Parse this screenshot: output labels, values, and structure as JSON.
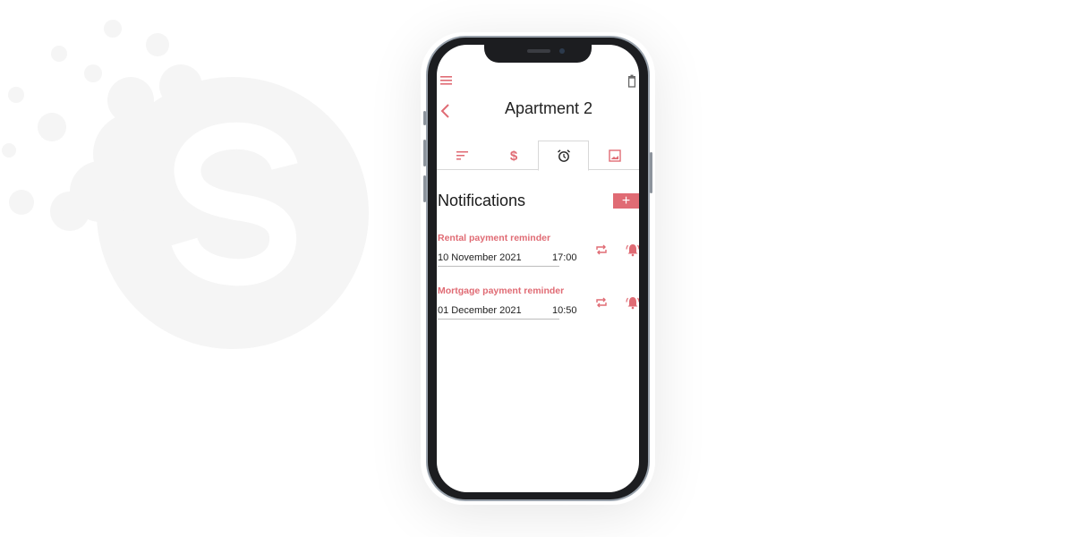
{
  "header": {
    "title": "Apartment 2",
    "menu_icon": "menu-icon",
    "trash_icon": "trash-icon",
    "back_icon": "chevron-left-icon"
  },
  "tabs": [
    {
      "name": "sort-icon",
      "active": false
    },
    {
      "name": "dollar-icon",
      "active": false
    },
    {
      "name": "alarm-clock-icon",
      "active": true
    },
    {
      "name": "image-icon",
      "active": false
    }
  ],
  "notifications": {
    "title": "Notifications",
    "add_label": "+",
    "items": [
      {
        "title": "Rental payment reminder",
        "date": "10 November 2021",
        "time": "17:00"
      },
      {
        "title": "Mortgage payment reminder",
        "date": "01 December 2021",
        "time": "10:50"
      }
    ]
  },
  "colors": {
    "accent": "#e06b74",
    "phone_frame": "#1c1d20",
    "watermark": "#f6f6f6"
  }
}
